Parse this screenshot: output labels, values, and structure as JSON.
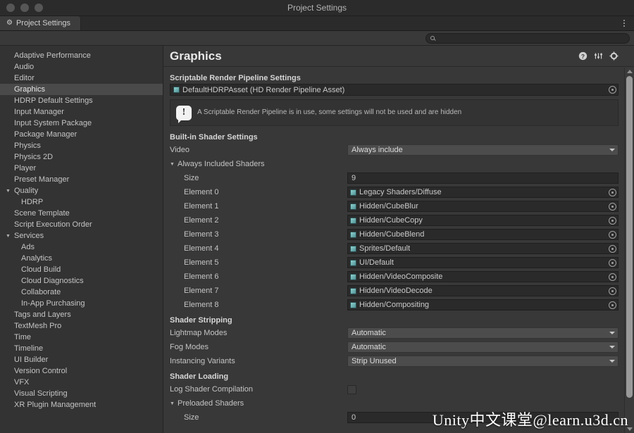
{
  "window": {
    "title": "Project Settings",
    "traffic_lights": [
      "close",
      "minimize",
      "zoom"
    ]
  },
  "tabbar": {
    "tab_label": "Project Settings",
    "tab_icon": "gear-icon",
    "overflow_icon": "kebab-menu-icon"
  },
  "search": {
    "value": "",
    "placeholder": "",
    "icon": "search-icon"
  },
  "sidebar": {
    "items": [
      {
        "label": "Adaptive Performance",
        "level": 0,
        "expandable": false,
        "selected": false
      },
      {
        "label": "Audio",
        "level": 0,
        "expandable": false,
        "selected": false
      },
      {
        "label": "Editor",
        "level": 0,
        "expandable": false,
        "selected": false
      },
      {
        "label": "Graphics",
        "level": 0,
        "expandable": false,
        "selected": true
      },
      {
        "label": "HDRP Default Settings",
        "level": 0,
        "expandable": false,
        "selected": false
      },
      {
        "label": "Input Manager",
        "level": 0,
        "expandable": false,
        "selected": false
      },
      {
        "label": "Input System Package",
        "level": 0,
        "expandable": false,
        "selected": false
      },
      {
        "label": "Package Manager",
        "level": 0,
        "expandable": false,
        "selected": false
      },
      {
        "label": "Physics",
        "level": 0,
        "expandable": false,
        "selected": false
      },
      {
        "label": "Physics 2D",
        "level": 0,
        "expandable": false,
        "selected": false
      },
      {
        "label": "Player",
        "level": 0,
        "expandable": false,
        "selected": false
      },
      {
        "label": "Preset Manager",
        "level": 0,
        "expandable": false,
        "selected": false
      },
      {
        "label": "Quality",
        "level": 0,
        "expandable": true,
        "selected": false
      },
      {
        "label": "HDRP",
        "level": 1,
        "expandable": false,
        "selected": false
      },
      {
        "label": "Scene Template",
        "level": 0,
        "expandable": false,
        "selected": false
      },
      {
        "label": "Script Execution Order",
        "level": 0,
        "expandable": false,
        "selected": false
      },
      {
        "label": "Services",
        "level": 0,
        "expandable": true,
        "selected": false
      },
      {
        "label": "Ads",
        "level": 1,
        "expandable": false,
        "selected": false
      },
      {
        "label": "Analytics",
        "level": 1,
        "expandable": false,
        "selected": false
      },
      {
        "label": "Cloud Build",
        "level": 1,
        "expandable": false,
        "selected": false
      },
      {
        "label": "Cloud Diagnostics",
        "level": 1,
        "expandable": false,
        "selected": false
      },
      {
        "label": "Collaborate",
        "level": 1,
        "expandable": false,
        "selected": false
      },
      {
        "label": "In-App Purchasing",
        "level": 1,
        "expandable": false,
        "selected": false
      },
      {
        "label": "Tags and Layers",
        "level": 0,
        "expandable": false,
        "selected": false
      },
      {
        "label": "TextMesh Pro",
        "level": 0,
        "expandable": false,
        "selected": false
      },
      {
        "label": "Time",
        "level": 0,
        "expandable": false,
        "selected": false
      },
      {
        "label": "Timeline",
        "level": 0,
        "expandable": false,
        "selected": false
      },
      {
        "label": "UI Builder",
        "level": 0,
        "expandable": false,
        "selected": false
      },
      {
        "label": "Version Control",
        "level": 0,
        "expandable": false,
        "selected": false
      },
      {
        "label": "VFX",
        "level": 0,
        "expandable": false,
        "selected": false
      },
      {
        "label": "Visual Scripting",
        "level": 0,
        "expandable": false,
        "selected": false
      },
      {
        "label": "XR Plugin Management",
        "level": 0,
        "expandable": false,
        "selected": false
      }
    ]
  },
  "panel": {
    "title": "Graphics",
    "header_icons": [
      "help-icon",
      "preset-icon",
      "settings-gear-icon"
    ]
  },
  "srp": {
    "section_title": "Scriptable Render Pipeline Settings",
    "asset_value": "DefaultHDRPAsset (HD Render Pipeline Asset)",
    "asset_icon": "asset-chip-icon",
    "picker_icon": "object-picker-icon",
    "helpbox": {
      "icon": "info-bubble-icon",
      "glyph": "!",
      "message": "A Scriptable Render Pipeline is in use, some settings will not be used and are hidden"
    }
  },
  "builtin_shader": {
    "section_title": "Built-in Shader Settings",
    "video": {
      "label": "Video",
      "value": "Always include"
    },
    "always_included": {
      "label": "Always Included Shaders",
      "expanded": true,
      "size_label": "Size",
      "size_value": "9",
      "elements": [
        {
          "label": "Element 0",
          "value": "Legacy Shaders/Diffuse"
        },
        {
          "label": "Element 1",
          "value": "Hidden/CubeBlur"
        },
        {
          "label": "Element 2",
          "value": "Hidden/CubeCopy"
        },
        {
          "label": "Element 3",
          "value": "Hidden/CubeBlend"
        },
        {
          "label": "Element 4",
          "value": "Sprites/Default"
        },
        {
          "label": "Element 5",
          "value": "UI/Default"
        },
        {
          "label": "Element 6",
          "value": "Hidden/VideoComposite"
        },
        {
          "label": "Element 7",
          "value": "Hidden/VideoDecode"
        },
        {
          "label": "Element 8",
          "value": "Hidden/Compositing"
        }
      ]
    }
  },
  "shader_stripping": {
    "section_title": "Shader Stripping",
    "rows": [
      {
        "label": "Lightmap Modes",
        "value": "Automatic"
      },
      {
        "label": "Fog Modes",
        "value": "Automatic"
      },
      {
        "label": "Instancing Variants",
        "value": "Strip Unused"
      }
    ]
  },
  "shader_loading": {
    "section_title": "Shader Loading",
    "log_shader_compilation": {
      "label": "Log Shader Compilation",
      "checked": false
    },
    "preloaded_shaders": {
      "label": "Preloaded Shaders",
      "expanded": true,
      "size_label": "Size",
      "size_value": "0"
    }
  },
  "scrollbar": {
    "up_icon": "scroll-up-arrow-icon",
    "down_icon": "scroll-down-arrow-icon"
  },
  "watermark": {
    "text": "Unity中文课堂@learn.u3d.cn"
  },
  "colors": {
    "window_bg": "#383838",
    "sidebar_bg": "#333333",
    "selection": "#4a4a4a",
    "field_bg": "#2a2a2a",
    "dropdown_bg": "#4c4c4c",
    "text": "#c4c4c4"
  }
}
